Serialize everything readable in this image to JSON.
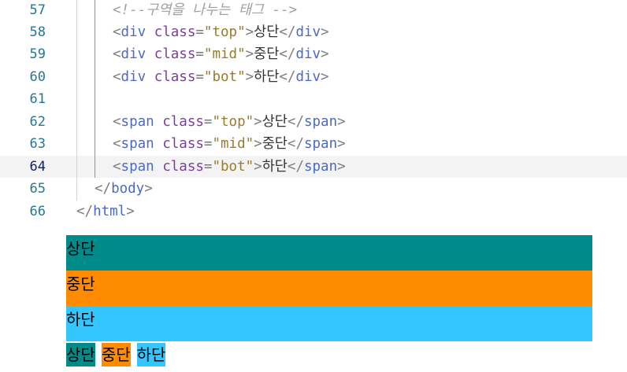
{
  "editor": {
    "current_line": "64",
    "lines": [
      {
        "num": "57",
        "indent": "    ",
        "tokens": {
          "comment": "<!--구역을 나누는 태그 -->"
        }
      },
      {
        "num": "58",
        "indent": "    ",
        "tokens": {
          "open_bracket": "<",
          "tag": "div",
          "attr": " class",
          "eq": "=",
          "value": "\"top\"",
          "close_bracket": ">",
          "text": "상단",
          "end_open": "</",
          "end_tag": "div",
          "end_close": ">"
        }
      },
      {
        "num": "59",
        "indent": "    ",
        "tokens": {
          "open_bracket": "<",
          "tag": "div",
          "attr": " class",
          "eq": "=",
          "value": "\"mid\"",
          "close_bracket": ">",
          "text": "중단",
          "end_open": "</",
          "end_tag": "div",
          "end_close": ">"
        }
      },
      {
        "num": "60",
        "indent": "    ",
        "tokens": {
          "open_bracket": "<",
          "tag": "div",
          "attr": " class",
          "eq": "=",
          "value": "\"bot\"",
          "close_bracket": ">",
          "text": "하단",
          "end_open": "</",
          "end_tag": "div",
          "end_close": ">"
        }
      },
      {
        "num": "61"
      },
      {
        "num": "62",
        "indent": "    ",
        "tokens": {
          "open_bracket": "<",
          "tag": "span",
          "attr": " class",
          "eq": "=",
          "value": "\"top\"",
          "close_bracket": ">",
          "text": "상단",
          "end_open": "</",
          "end_tag": "span",
          "end_close": ">"
        }
      },
      {
        "num": "63",
        "indent": "    ",
        "tokens": {
          "open_bracket": "<",
          "tag": "span",
          "attr": " class",
          "eq": "=",
          "value": "\"mid\"",
          "close_bracket": ">",
          "text": "중단",
          "end_open": "</",
          "end_tag": "span",
          "end_close": ">"
        }
      },
      {
        "num": "64",
        "indent": "    ",
        "tokens": {
          "open_bracket": "<",
          "tag": "span",
          "attr": " class",
          "eq": "=",
          "value": "\"bot\"",
          "close_bracket": ">",
          "text": "하단",
          "end_open": "</",
          "end_tag": "span",
          "end_close": ">"
        }
      },
      {
        "num": "65",
        "indent": "  ",
        "tokens": {
          "end_open": "</",
          "end_tag": "body",
          "end_close": ">"
        }
      },
      {
        "num": "66",
        "indent": "",
        "tokens": {
          "end_open": "</",
          "end_tag": "html",
          "end_close": ">"
        }
      }
    ]
  },
  "preview": {
    "blocks": [
      {
        "label": "상단",
        "color": "#008b8b"
      },
      {
        "label": "중단",
        "color": "#ff8c00"
      },
      {
        "label": "하단",
        "color": "#33c6ff"
      }
    ],
    "inlines": [
      {
        "label": "상단",
        "color": "#008b8b"
      },
      {
        "label": "중단",
        "color": "#ff8c00"
      },
      {
        "label": "하단",
        "color": "#33c6ff"
      }
    ]
  }
}
